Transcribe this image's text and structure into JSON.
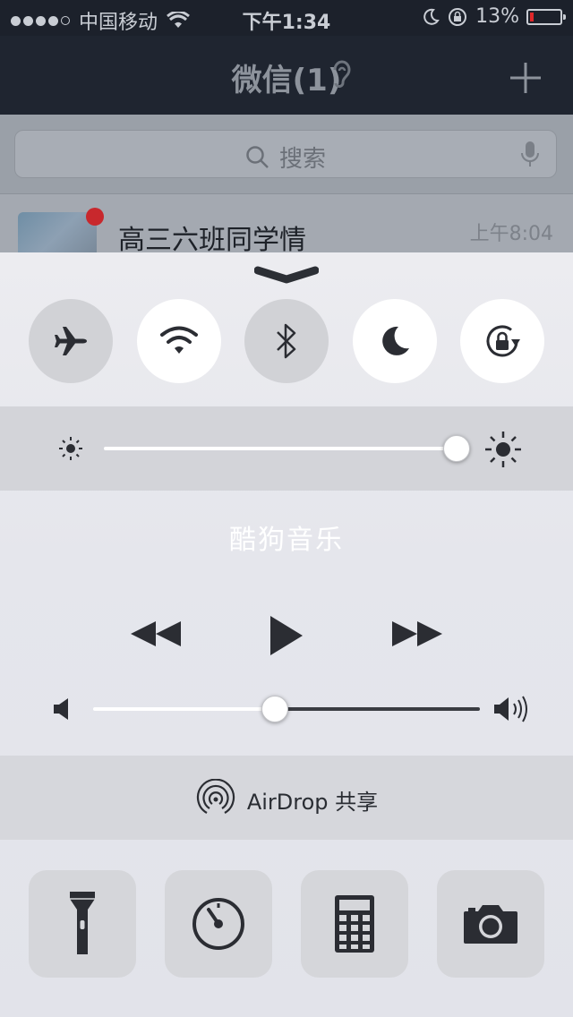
{
  "status_bar": {
    "carrier": "中国移动",
    "time": "下午1:34",
    "battery_percent": "13%",
    "signal_bars": 4,
    "icons": [
      "signal-dots-icon",
      "wifi-icon",
      "moon-icon",
      "rotation-lock-icon",
      "battery-icon"
    ]
  },
  "app": {
    "title": "微信(1)",
    "search_placeholder": "搜索",
    "chat": {
      "name": "高三六班同学情",
      "time": "上午8:04"
    }
  },
  "control_center": {
    "toggles": [
      {
        "name": "airplane-mode",
        "icon": "airplane-icon",
        "on": false
      },
      {
        "name": "wifi",
        "icon": "wifi-icon",
        "on": true
      },
      {
        "name": "bluetooth",
        "icon": "bluetooth-icon",
        "on": false
      },
      {
        "name": "do-not-disturb",
        "icon": "moon-icon",
        "on": true
      },
      {
        "name": "rotation-lock",
        "icon": "rotation-lock-icon",
        "on": true
      }
    ],
    "brightness": 1.0,
    "music_title": "酷狗音乐",
    "volume": 0.47,
    "airdrop_label": "AirDrop 共享",
    "shortcuts": [
      "flashlight-icon",
      "timer-icon",
      "calculator-icon",
      "camera-icon"
    ]
  }
}
